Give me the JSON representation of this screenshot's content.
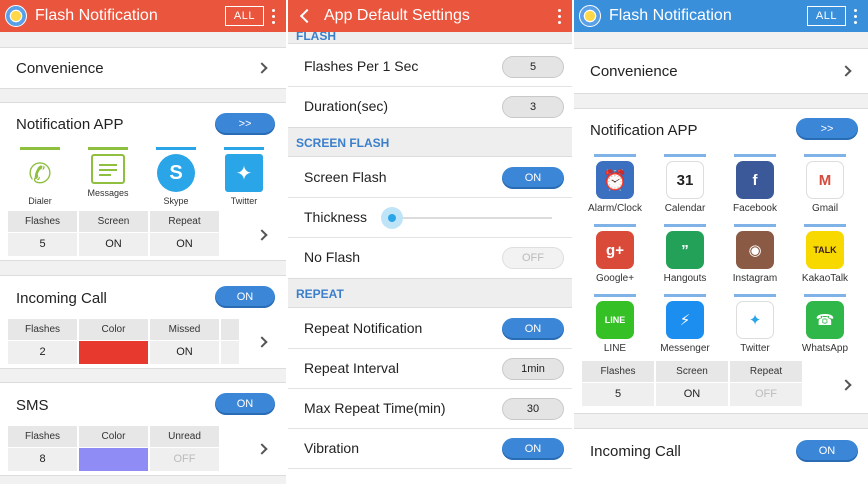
{
  "panel1": {
    "title": "Flash Notification",
    "all_label": "ALL",
    "convenience": "Convenience",
    "notification_app": {
      "title": "Notification APP",
      "button": ">>"
    },
    "apps": [
      {
        "name": "Dialer",
        "icon": "phone-icon",
        "color": "#8fbf3f"
      },
      {
        "name": "Messages",
        "icon": "messages-icon",
        "color": "#8fbf3f"
      },
      {
        "name": "Skype",
        "icon": "skype-icon",
        "color": "#2aa5e8"
      },
      {
        "name": "Twitter",
        "icon": "twitter-icon",
        "color": "#2aa5e8"
      }
    ],
    "app_grid": {
      "headers": [
        "Flashes",
        "Screen",
        "Repeat"
      ],
      "values": [
        "5",
        "ON",
        "ON"
      ]
    },
    "incoming_call": {
      "title": "Incoming Call",
      "toggle": "ON",
      "headers": [
        "Flashes",
        "Color",
        "Missed"
      ],
      "flashes": "2",
      "color": "#e8392e",
      "missed": "ON"
    },
    "sms": {
      "title": "SMS",
      "toggle": "ON",
      "headers": [
        "Flashes",
        "Color",
        "Unread"
      ],
      "flashes": "8",
      "color": "#8f8cf5",
      "unread": "OFF"
    }
  },
  "panel2": {
    "title": "App Default Settings",
    "flash_section_partial": "FLASH",
    "flashes_per_sec": {
      "label": "Flashes Per 1 Sec",
      "value": "5"
    },
    "duration": {
      "label": "Duration(sec)",
      "value": "3"
    },
    "screen_flash_header": "SCREEN FLASH",
    "screen_flash": {
      "label": "Screen Flash",
      "value": "ON"
    },
    "thickness": {
      "label": "Thickness",
      "level": 0.05
    },
    "no_flash": {
      "label": "No Flash",
      "value": "OFF"
    },
    "repeat_header": "REPEAT",
    "repeat_notification": {
      "label": "Repeat Notification",
      "value": "ON"
    },
    "repeat_interval": {
      "label": "Repeat Interval",
      "value": "1min"
    },
    "max_repeat": {
      "label": "Max Repeat Time(min)",
      "value": "30"
    },
    "vibration": {
      "label": "Vibration",
      "value": "ON"
    }
  },
  "panel3": {
    "title": "Flash Notification",
    "all_label": "ALL",
    "convenience": "Convenience",
    "notification_app": {
      "title": "Notification APP",
      "button": ">>"
    },
    "apps": [
      {
        "name": "Alarm/Clock",
        "icon": "alarm-clock-icon",
        "bg": "#3b6fc0"
      },
      {
        "name": "Calendar",
        "icon": "calendar-icon",
        "bg": "#ffffff",
        "glyph": "31"
      },
      {
        "name": "Facebook",
        "icon": "facebook-icon",
        "bg": "#3b5998",
        "glyph": "f"
      },
      {
        "name": "Gmail",
        "icon": "gmail-icon",
        "bg": "#ffffff",
        "glyph": "M"
      },
      {
        "name": "Google+",
        "icon": "google-plus-icon",
        "bg": "#d94a38",
        "glyph": "g+"
      },
      {
        "name": "Hangouts",
        "icon": "hangouts-icon",
        "bg": "#24a159",
        "glyph": "”"
      },
      {
        "name": "Instagram",
        "icon": "instagram-icon",
        "bg": "#8a5a44",
        "glyph": "◉"
      },
      {
        "name": "KakaoTalk",
        "icon": "kakaotalk-icon",
        "bg": "#f7d900",
        "glyph": "TALK"
      },
      {
        "name": "LINE",
        "icon": "line-icon",
        "bg": "#35c026",
        "glyph": "LINE"
      },
      {
        "name": "Messenger",
        "icon": "messenger-icon",
        "bg": "#1c8ef0",
        "glyph": "⚡"
      },
      {
        "name": "Twitter",
        "icon": "twitter-icon",
        "bg": "#ffffff",
        "glyph": "✦"
      },
      {
        "name": "WhatsApp",
        "icon": "whatsapp-icon",
        "bg": "#2fb74a",
        "glyph": "☎"
      }
    ],
    "app_grid": {
      "headers": [
        "Flashes",
        "Screen",
        "Repeat"
      ],
      "values": [
        "5",
        "ON",
        "OFF"
      ]
    },
    "incoming_call": {
      "title": "Incoming Call",
      "toggle": "ON"
    }
  }
}
